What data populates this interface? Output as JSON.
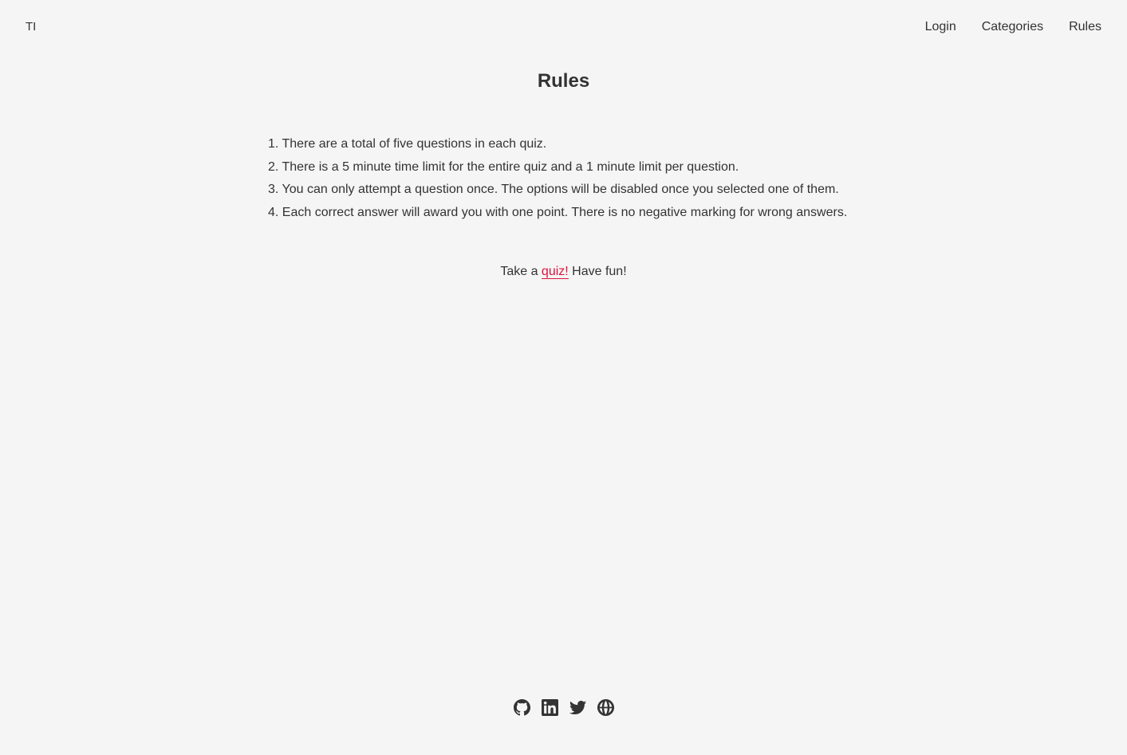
{
  "header": {
    "logo": "TI",
    "nav": [
      {
        "label": "Login"
      },
      {
        "label": "Categories"
      },
      {
        "label": "Rules"
      }
    ]
  },
  "main": {
    "title": "Rules",
    "rules": [
      {
        "number": "1.",
        "text": "There are a total of five questions in each quiz."
      },
      {
        "number": "2.",
        "text": "There is a 5 minute time limit for the entire quiz and a 1 minute limit per question."
      },
      {
        "number": "3.",
        "text": "You can only attempt a question once. The options will be disabled once you selected one of them."
      },
      {
        "number": "4.",
        "text": "Each correct answer will award you with one point. There is no negative marking for wrong answers."
      }
    ],
    "cta": {
      "prefix": "Take a ",
      "link": "quiz!",
      "suffix": " Have fun!"
    }
  },
  "footer": {
    "icons": [
      "github-icon",
      "linkedin-icon",
      "twitter-icon",
      "globe-icon"
    ]
  },
  "colors": {
    "background": "#f5f5f5",
    "text": "#333333",
    "accent": "#dc143c"
  }
}
